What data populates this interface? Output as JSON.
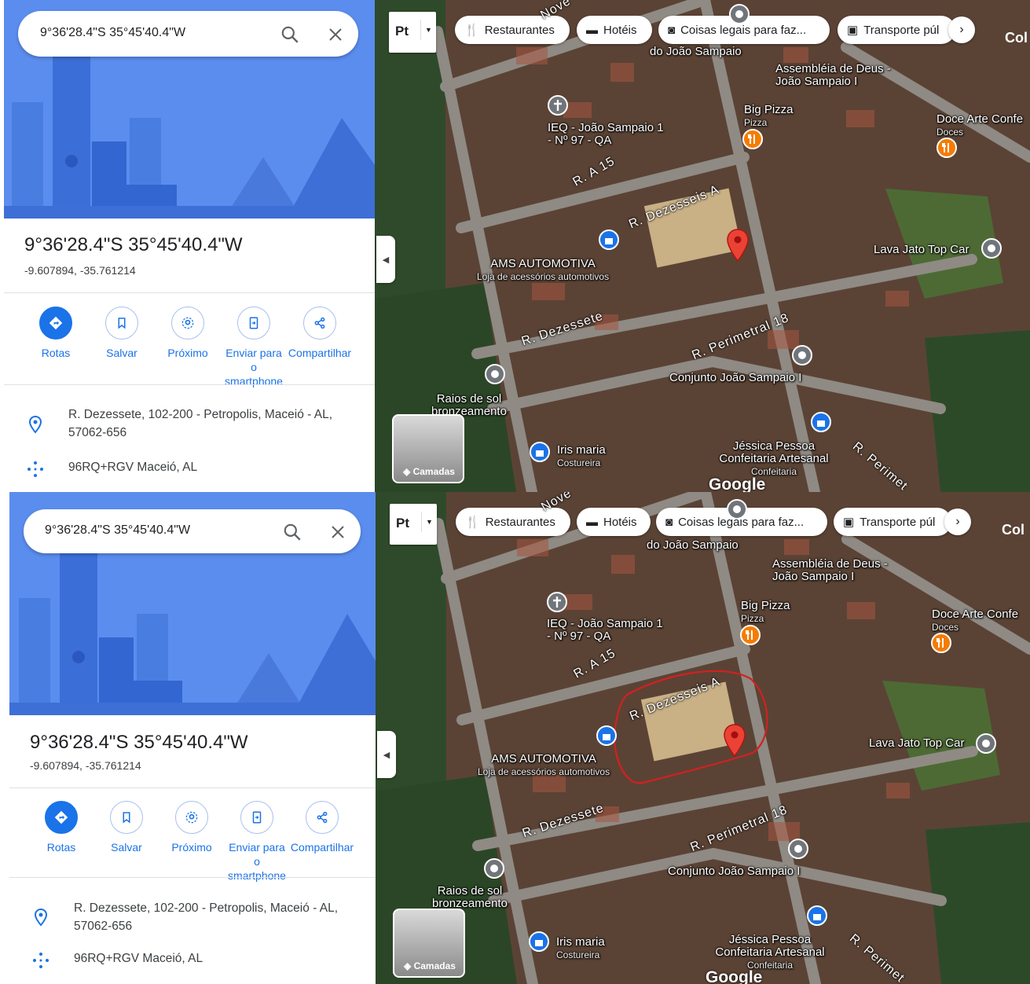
{
  "panels": [
    {
      "search": {
        "query": "9°36'28.4\"S 35°45'40.4\"W"
      },
      "place": {
        "title": "9°36'28.4\"S 35°45'40.4\"W",
        "coords": "-9.607894, -35.761214"
      },
      "actions": [
        "Rotas",
        "Salvar",
        "Próximo",
        "Enviar para o smartphone",
        "Compartilhar"
      ],
      "address": "R. Dezessete, 102-200 - Petropolis, Maceió - AL, 57062-656",
      "plus_code": "96RQ+RGV Maceió, AL"
    },
    {
      "search": {
        "query": "9°36'28.4\"S 35°45'40.4\"W"
      },
      "place": {
        "title": "9°36'28.4\"S 35°45'40.4\"W",
        "coords": "-9.607894, -35.761214"
      },
      "actions": [
        "Rotas",
        "Salvar",
        "Próximo",
        "Enviar para o smartphone",
        "Compartilhar"
      ],
      "address": "R. Dezessete, 102-200 - Petropolis, Maceió - AL, 57062-656",
      "plus_code": "96RQ+RGV Maceió, AL"
    }
  ],
  "map": {
    "lang_label": "Pt",
    "chips": [
      "Restaurantes",
      "Hotéis",
      "Coisas legais para faz...",
      "Transporte púl"
    ],
    "layers_label": "Camadas",
    "logo": "Google",
    "apps_partial": "Col",
    "streets": [
      "R. Dezesseis A",
      "R. A 15",
      "R. Dezessete",
      "R. Perimetral 18",
      "Nove",
      "R. Perimet"
    ],
    "top_partial": "do João Sampaio",
    "places": [
      {
        "name": "Assembléia de Deus - João Sampaio I",
        "category": ""
      },
      {
        "name": "IEQ - João Sampaio 1 - Nº 97 - QA",
        "category": ""
      },
      {
        "name": "Big Pizza",
        "category": "Pizza"
      },
      {
        "name": "Doce Arte Confe",
        "category": "Doces"
      },
      {
        "name": "AMS AUTOMOTIVA",
        "category": "Loja de acessórios automotivos"
      },
      {
        "name": "Lava Jato Top Car",
        "category": ""
      },
      {
        "name": "Conjunto João Sampaio I",
        "category": ""
      },
      {
        "name": "Raios de sol bronzeamento",
        "category": ""
      },
      {
        "name": "Iris maria",
        "category": "Costureira"
      },
      {
        "name": "Jéssica Pessoa Confeitaria Artesanal",
        "category": "Confeitaria"
      }
    ],
    "colors": {
      "pin": "#ea4335",
      "food": "#f57c00",
      "shop": "#1a73e8",
      "grey": "#70757a",
      "annotation": "#d42020"
    }
  }
}
